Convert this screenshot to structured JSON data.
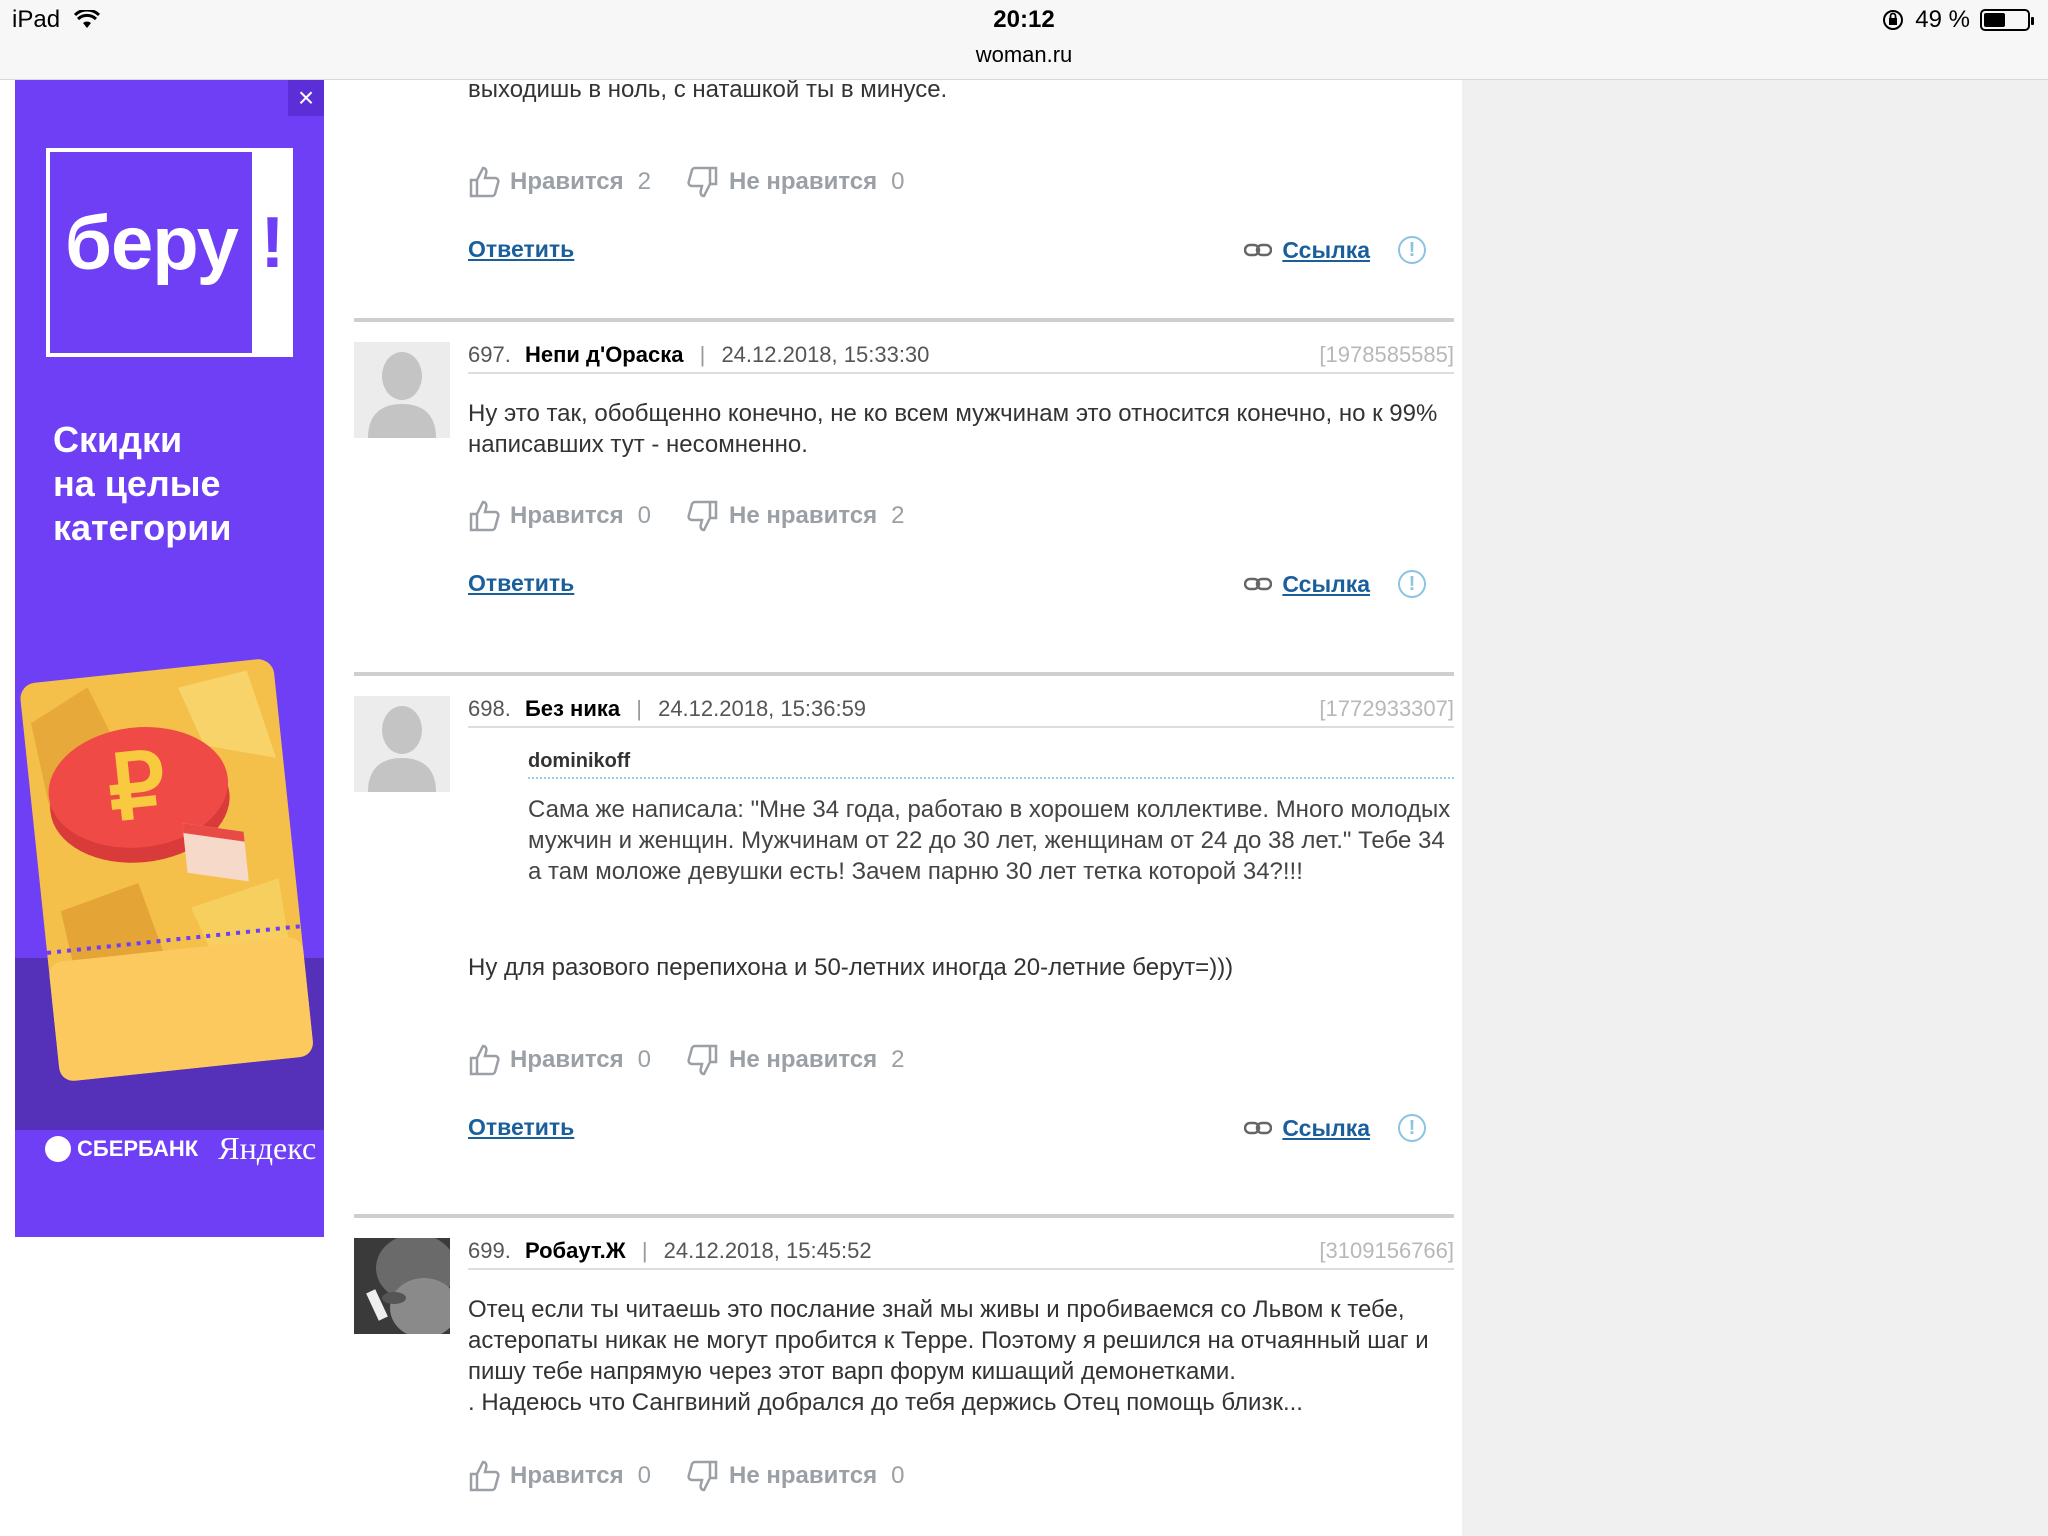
{
  "status_bar": {
    "device": "iPad",
    "time": "20:12",
    "url": "woman.ru",
    "battery_text": "49 %",
    "battery_level": 0.49
  },
  "ad": {
    "close": "×",
    "logo_text": "беру",
    "logo_mark": "!",
    "slogan_lines": [
      "Скидки",
      "на целые",
      "категории"
    ],
    "sponsor1": "СБЕРБАНК",
    "sponsor2": "Яндекс",
    "bg_color": "#6e3ff5"
  },
  "labels": {
    "like": "Нравится",
    "dislike": "Не нравится",
    "reply": "Ответить",
    "link": "Ссылка",
    "report": "!"
  },
  "top_fragment": {
    "text": "выходишь в ноль, с наташкой ты в минусе.",
    "likes": "2",
    "dislikes": "0"
  },
  "comments": [
    {
      "number": "697.",
      "author": "Непи д'Ораска",
      "date": "24.12.2018, 15:33:30",
      "id": "[1978585585]",
      "text": "Ну это так, обобщенно конечно, не ко всем мужчинам это относится конечно, но к 99% написавших тут - несомненно.",
      "likes": "0",
      "dislikes": "2"
    },
    {
      "number": "698.",
      "author": "Без ника",
      "date": "24.12.2018, 15:36:59",
      "id": "[1772933307]",
      "quote_author": "dominikoff",
      "quote": "Сама же написала: \"Мне 34 года, работаю в хорошем коллективе. Много молодых мужчин и женщин. Мужчинам от 22 до 30 лет, женщинам от 24 до 38 лет.\" Тебе 34 а там моложе девушки есть! Зачем парню 30 лет тетка которой 34?!!!",
      "text": "Ну для разового перепихона и 50-летних иногда 20-летние берут=)))",
      "likes": "0",
      "dislikes": "2"
    },
    {
      "number": "699.",
      "author": "Робаут.Ж",
      "date": "24.12.2018, 15:45:52",
      "id": "[3109156766]",
      "text": "Отец если ты читаешь это послание знай мы живы и пробиваемся со Львом к тебе, астеропаты никак не могут пробится к Терре. Поэтому я решился на отчаянный шаг и пишу тебе напрямую через этот варп форум кишащий демонетками.\n. Надеюсь что Сангвиний добрался до тебя держись Отец помощь близк...",
      "likes": "0",
      "dislikes": "0"
    }
  ]
}
